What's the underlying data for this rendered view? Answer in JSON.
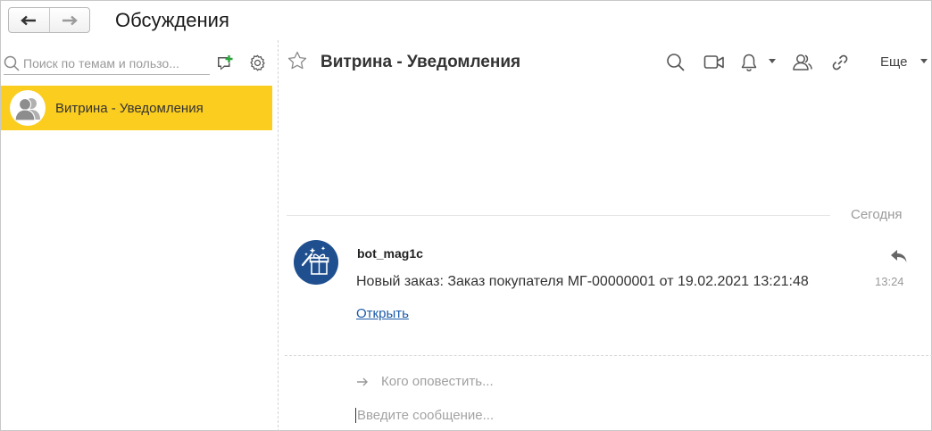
{
  "window": {
    "title": "Обсуждения"
  },
  "sidebar": {
    "search_placeholder": "Поиск по темам и пользо...",
    "conversations": [
      {
        "name": "Витрина  - Уведомления",
        "selected": true
      }
    ]
  },
  "chat": {
    "title": "Витрина - Уведомления",
    "more_label": "Еще",
    "date_separator": "Сегодня",
    "messages": [
      {
        "author": "bot_mag1c",
        "text": "Новый заказ: Заказ покупателя МГ-00000001 от 19.02.2021 13:21:48",
        "link_label": "Открыть",
        "time": "13:24"
      }
    ],
    "notify_placeholder": "Кого оповестить...",
    "compose_placeholder": "Введите сообщение..."
  },
  "colors": {
    "selected_bg": "#fbcd1f",
    "link": "#1c5aa8",
    "bot_avatar": "#1f4f8f",
    "add_green": "#2aa33a"
  },
  "icons": [
    "back-arrow-icon",
    "forward-arrow-icon",
    "new-chat-icon",
    "gear-icon",
    "user-avatar-icon",
    "star-icon",
    "search-icon",
    "video-icon",
    "bell-icon",
    "users-icon",
    "link-icon",
    "chevron-down-icon",
    "gift-icon",
    "reply-icon",
    "arrow-right-icon"
  ]
}
